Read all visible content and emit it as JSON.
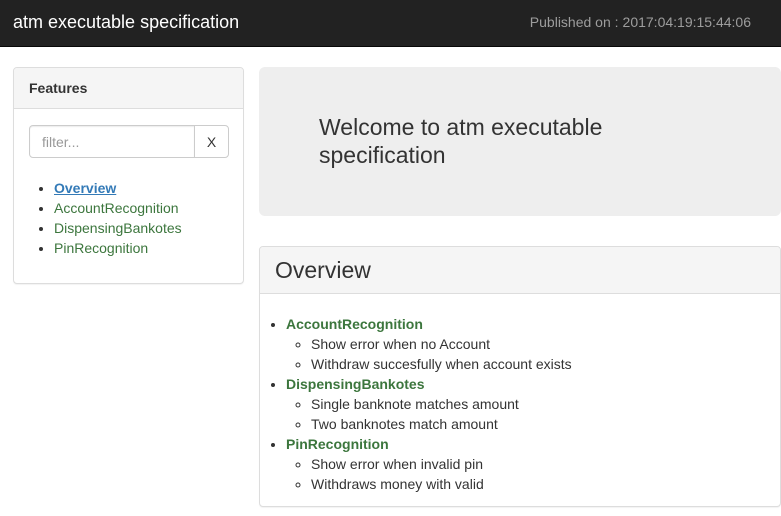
{
  "navbar": {
    "brand": "atm executable specification",
    "published_label": "Published on :",
    "published_value": "2017:04:19:15:44:06"
  },
  "sidebar": {
    "heading": "Features",
    "filter_placeholder": "filter...",
    "clear_label": "X",
    "items": [
      {
        "label": "Overview",
        "active": true
      },
      {
        "label": "AccountRecognition"
      },
      {
        "label": "DispensingBankotes"
      },
      {
        "label": "PinRecognition"
      }
    ]
  },
  "jumbotron": {
    "title": "Welcome to atm executable specification"
  },
  "overview": {
    "heading": "Overview",
    "features": [
      {
        "name": "AccountRecognition",
        "scenarios": [
          "Show error when no Account",
          "Withdraw succesfully when account exists"
        ]
      },
      {
        "name": "DispensingBankotes",
        "scenarios": [
          "Single banknote matches amount",
          "Two banknotes match amount"
        ]
      },
      {
        "name": "PinRecognition",
        "scenarios": [
          "Show error when invalid pin",
          "Withdraws money with valid"
        ]
      }
    ]
  },
  "colors": {
    "navbar_bg": "#222222",
    "feature_link": "#3c763d",
    "active_link": "#337ab7",
    "jumbotron_bg": "#eeeeee"
  }
}
